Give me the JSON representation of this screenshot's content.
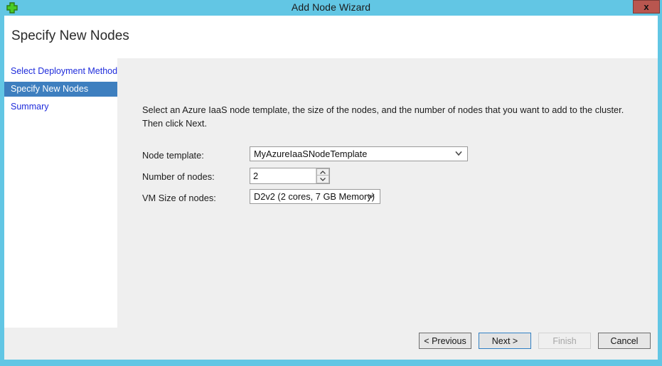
{
  "window": {
    "title": "Add Node Wizard",
    "icon": "green-plus-icon",
    "close_label": "x",
    "accent_color": "#62c6e4",
    "close_button_color": "#b9564f"
  },
  "header": {
    "title": "Specify New Nodes"
  },
  "sidebar": {
    "items": [
      {
        "label": "Select Deployment Method",
        "active": false
      },
      {
        "label": "Specify New Nodes",
        "active": true
      },
      {
        "label": "Summary",
        "active": false
      }
    ],
    "active_color": "#3e7fbf",
    "link_color": "#1e2bdb"
  },
  "main": {
    "instruction": "Select an Azure IaaS node template, the size of the nodes, and the number of nodes that you want to add to the cluster. Then click Next.",
    "fields": {
      "node_template": {
        "label": "Node template:",
        "value": "MyAzureIaaSNodeTemplate",
        "icon": "chevron-down-icon"
      },
      "number_of_nodes": {
        "label": "Number of nodes:",
        "value": "2",
        "up_icon": "chevron-up-icon",
        "down_icon": "chevron-down-icon"
      },
      "vm_size": {
        "label": "VM Size of nodes:",
        "value": "D2v2 (2 cores, 7 GB Memory)",
        "icon": "chevron-down-icon"
      }
    }
  },
  "footer": {
    "buttons": [
      {
        "label": "< Previous",
        "state": "normal"
      },
      {
        "label": "Next >",
        "state": "focused"
      },
      {
        "label": "Finish",
        "state": "disabled"
      },
      {
        "label": "Cancel",
        "state": "normal"
      }
    ]
  }
}
